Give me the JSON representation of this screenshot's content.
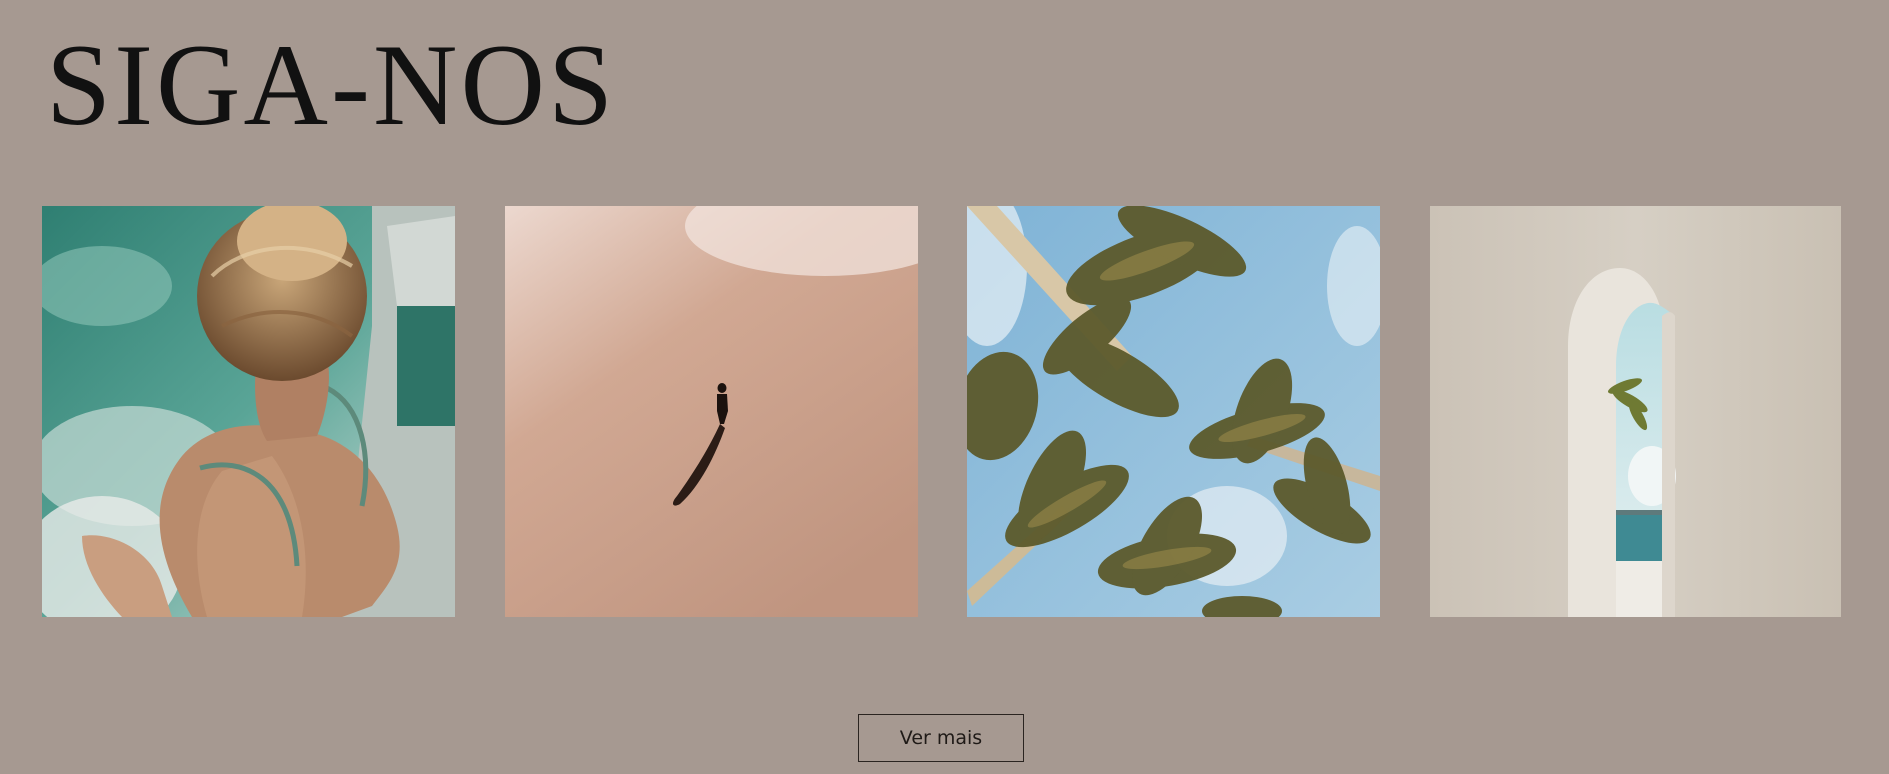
{
  "header": {
    "title": "SIGA-NOS"
  },
  "gallery": {
    "items": [
      {
        "icon": "woman-in-pool-photo"
      },
      {
        "icon": "person-on-beach-photo"
      },
      {
        "icon": "palm-trees-sky-photo"
      },
      {
        "icon": "archway-sea-view-photo"
      }
    ]
  },
  "actions": {
    "more_label": "Ver mais"
  },
  "colors": {
    "background": "#a69991",
    "text": "#111111",
    "button_border": "#2a2420"
  }
}
